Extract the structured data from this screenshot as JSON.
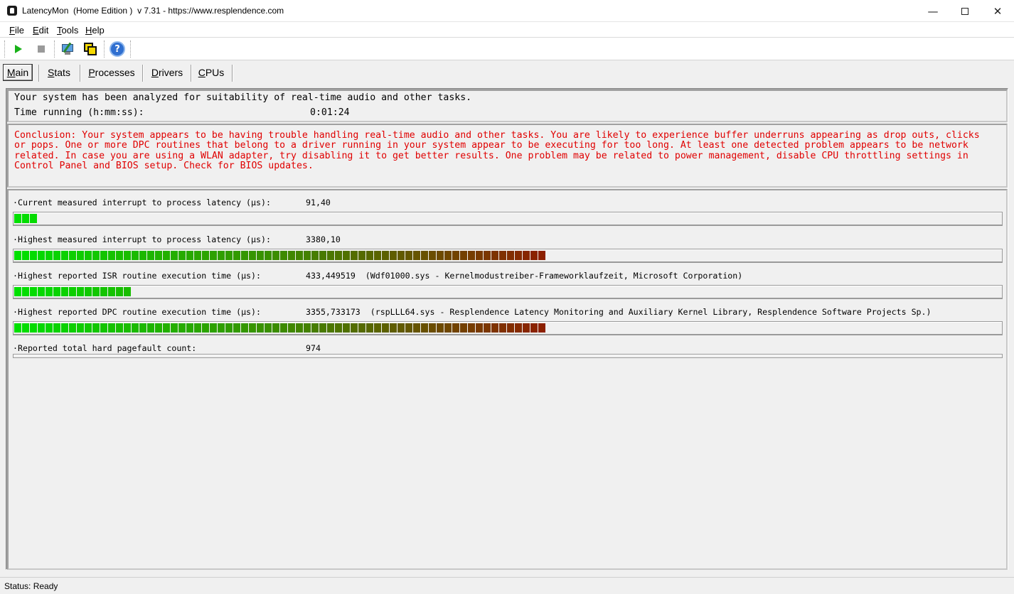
{
  "window": {
    "title": "LatencyMon  (Home Edition )  v 7.31 - https://www.resplendence.com",
    "minimize": "—",
    "close": "✕"
  },
  "menu": [
    {
      "hotkey": "F",
      "rest": "ile"
    },
    {
      "hotkey": "E",
      "rest": "dit"
    },
    {
      "hotkey": "T",
      "rest": "ools"
    },
    {
      "hotkey": "H",
      "rest": "elp"
    }
  ],
  "toolbar": {
    "icons": [
      "play-icon",
      "stop-icon",
      "tools-icon",
      "copy-icon",
      "help-icon"
    ],
    "help_glyph": "?"
  },
  "tabs": [
    {
      "hotkey": "M",
      "rest": "ain",
      "active": true
    },
    {
      "hotkey": "S",
      "rest": "tats",
      "active": false
    },
    {
      "hotkey": "P",
      "rest": "rocesses",
      "active": false
    },
    {
      "hotkey": "D",
      "rest": "rivers",
      "active": false
    },
    {
      "hotkey": "C",
      "rest": "PUs",
      "active": false
    }
  ],
  "info": {
    "line1": "Your system has been analyzed for suitability of real-time audio and other tasks.",
    "time_label": "Time running (h:mm:ss):",
    "time_value": "0:01:24"
  },
  "conclusion": "Conclusion: Your system appears to be having trouble handling real-time audio and other tasks. You are likely to experience buffer underruns appearing as drop outs, clicks or pops. One or more DPC routines that belong to a driver running in your system appear to be executing for too long. At least one detected problem appears to be network related. In case you are using a WLAN adapter, try disabling it to get better results. One problem may be related to power management, disable CPU throttling settings in Control Panel and BIOS setup. Check for BIOS updates.",
  "metrics": [
    {
      "label": "·Current measured interrupt to process latency (µs):",
      "value": "91,40",
      "segments": 3
    },
    {
      "label": "·Highest measured interrupt to process latency (µs):",
      "value": "3380,10",
      "segments": 68
    },
    {
      "label": "·Highest reported ISR routine execution time (µs):",
      "value": "433,449519  (Wdf01000.sys - Kernelmodustreiber-Frameworklaufzeit, Microsoft Corporation)",
      "segments": 15
    },
    {
      "label": "·Highest reported DPC routine execution time (µs):",
      "value": "3355,733173  (rspLLL64.sys - Resplendence Latency Monitoring and Auxiliary Kernel Library, Resplendence Software Projects Sp.)",
      "segments": 68
    },
    {
      "label": "·Reported total hard pagefault count:",
      "value": "974",
      "segments": 0
    }
  ],
  "colors": {
    "bar_start": "#00e000",
    "bar_mid": "#3c8c00",
    "bar_end": "#8c2000",
    "conclusion_text": "#e00000"
  },
  "status": "Status: Ready"
}
